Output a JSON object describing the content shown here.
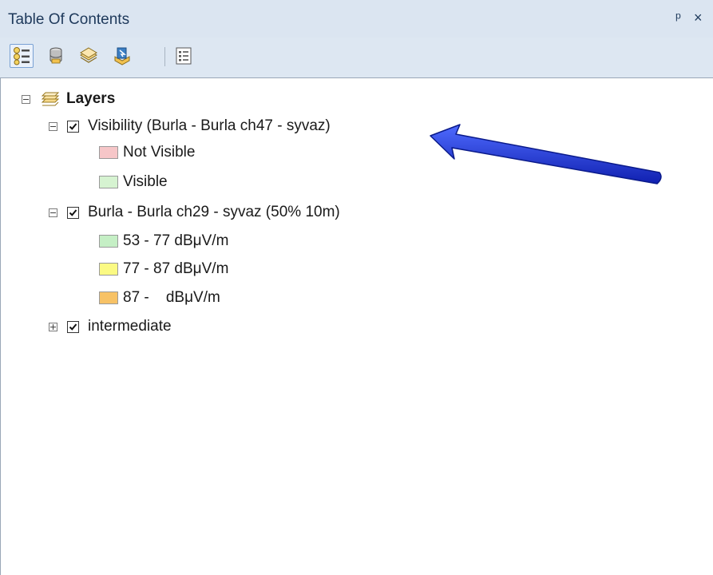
{
  "window": {
    "title": "Table Of Contents",
    "pin_glyph": "ᵖ",
    "close_glyph": "×"
  },
  "toolbar": {
    "buttons": [
      {
        "name": "list-by-drawing-order",
        "icon": "list-by-drawing-order-icon",
        "active": true
      },
      {
        "name": "list-by-source",
        "icon": "database-icon",
        "active": false
      },
      {
        "name": "list-by-visibility",
        "icon": "layers-visibility-icon",
        "active": false
      },
      {
        "name": "list-by-selection",
        "icon": "selection-icon",
        "active": false
      },
      {
        "name": "options",
        "icon": "options-icon",
        "active": false
      }
    ]
  },
  "toc": {
    "root": {
      "label": "Layers",
      "expanded": true
    },
    "layers": [
      {
        "label": "Visibility (Burla - Burla ch47 - syvaz)",
        "checked": true,
        "expanded": true,
        "legend": [
          {
            "label": "Not Visible",
            "color": "#f6c6c8"
          },
          {
            "label": "Visible",
            "color": "#d6f3d1"
          }
        ]
      },
      {
        "label": "Burla - Burla ch29 - syvaz (50% 10m)",
        "checked": true,
        "expanded": true,
        "legend": [
          {
            "label": "53 - 77 dBμV/m",
            "color": "#c5efc5"
          },
          {
            "label": "77 - 87 dBμV/m",
            "color": "#fbfa83"
          },
          {
            "label": "87 -    dBμV/m",
            "color": "#f7c266"
          }
        ]
      },
      {
        "label": "intermediate",
        "checked": true,
        "expanded": false,
        "legend": []
      }
    ]
  },
  "annotation": {
    "arrow_color": "#1d2fd6"
  }
}
